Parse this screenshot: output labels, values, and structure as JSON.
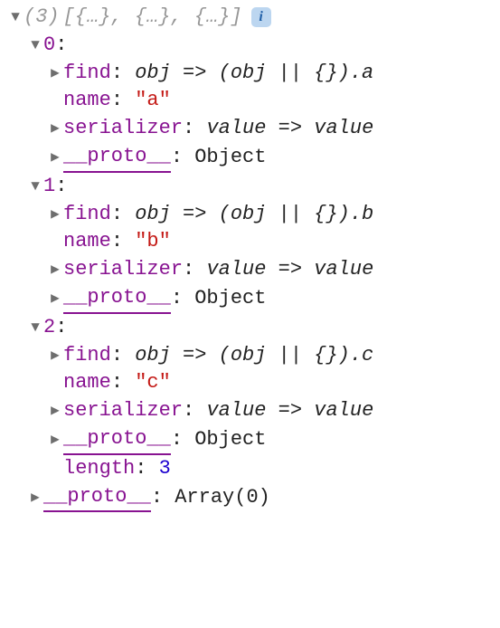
{
  "summary": {
    "count_label": "(3)",
    "preview": "[{…}, {…}, {…}]",
    "info_glyph": "i"
  },
  "entries": [
    {
      "index_label": "0",
      "find_key": "find",
      "find_value": "obj => (obj || {}).a",
      "name_key": "name",
      "name_value": "\"a\"",
      "serializer_key": "serializer",
      "serializer_value": "value => value",
      "proto_key": "__proto__",
      "proto_value": "Object"
    },
    {
      "index_label": "1",
      "find_key": "find",
      "find_value": "obj => (obj || {}).b",
      "name_key": "name",
      "name_value": "\"b\"",
      "serializer_key": "serializer",
      "serializer_value": "value => value",
      "proto_key": "__proto__",
      "proto_value": "Object"
    },
    {
      "index_label": "2",
      "find_key": "find",
      "find_value": "obj => (obj || {}).c",
      "name_key": "name",
      "name_value": "\"c\"",
      "serializer_key": "serializer",
      "serializer_value": "value => value",
      "proto_key": "__proto__",
      "proto_value": "Object"
    }
  ],
  "footer": {
    "length_key": "length",
    "length_value": "3",
    "proto_key": "__proto__",
    "proto_value": "Array(0)"
  }
}
